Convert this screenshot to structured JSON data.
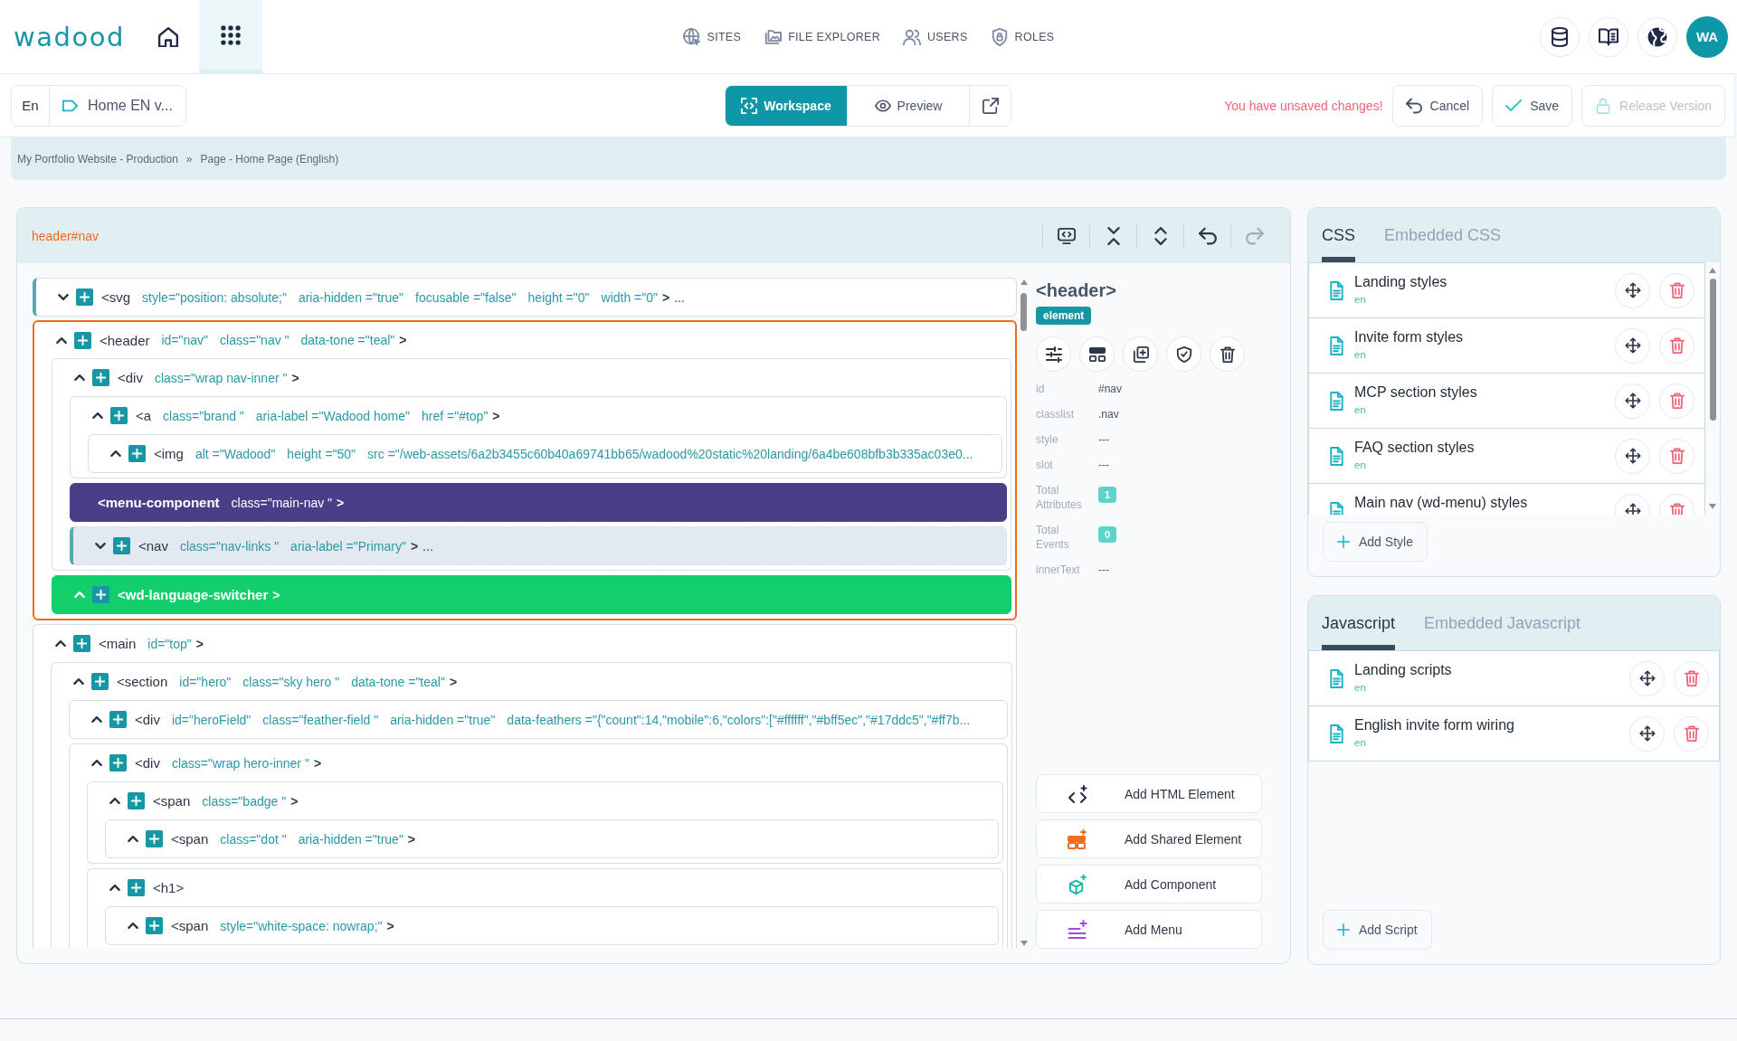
{
  "topbar": {
    "logo": "wadood",
    "home_button": {
      "selected": false
    },
    "apps_button": {
      "selected": true
    },
    "nav": [
      {
        "label": "SITES"
      },
      {
        "label": "FILE EXPLORER"
      },
      {
        "label": "USERS"
      },
      {
        "label": "ROLES"
      }
    ],
    "avatar": "WA"
  },
  "toolbar": {
    "language": "En",
    "page": "Home EN v...",
    "views": [
      {
        "label": "Workspace",
        "selected": true
      },
      {
        "label": "Preview",
        "selected": false
      }
    ],
    "notice": "You have unsaved changes!",
    "actions": [
      {
        "label": "Cancel",
        "disabled": false
      },
      {
        "label": "Save",
        "disabled": false
      },
      {
        "label": "Release Version",
        "disabled": true
      }
    ]
  },
  "breadcrumb": {
    "items": [
      "My Portfolio Website - Production",
      "Page - Home Page (English)"
    ],
    "separator": "»"
  },
  "editor": {
    "path": "header#nav",
    "tools": [
      {
        "disabled": false
      },
      {
        "disabled": false
      },
      {
        "disabled": false
      },
      {
        "disabled": false
      },
      {
        "disabled": true
      }
    ],
    "tree": [
      {
        "tag": "<svg",
        "attributes": [
          "style=\"position: absolute;\"",
          "aria-hidden =\"true\"",
          "focusable =\"false\"",
          "height =\"0\"",
          "width =\"0\""
        ],
        "end": ">",
        "more": "...",
        "kind": "element",
        "expanded": false,
        "selected": false,
        "highlighted": false
      },
      {
        "tag": "<header",
        "attributes": [
          "id=\"nav\"",
          "class=\"nav \"",
          "data-tone =\"teal\""
        ],
        "end": ">",
        "kind": "element",
        "expanded": true,
        "selected": true,
        "highlighted": false,
        "children": [
          {
            "tag": "<div",
            "attributes": [
              "class=\"wrap nav-inner \""
            ],
            "end": ">",
            "kind": "element",
            "expanded": true,
            "selected": false,
            "highlighted": false,
            "children": [
              {
                "tag": "<a",
                "attributes": [
                  "class=\"brand \"",
                  "aria-label =\"Wadood home\"",
                  "href =\"#top\""
                ],
                "end": ">",
                "kind": "element",
                "expanded": true,
                "selected": false,
                "highlighted": false,
                "children": [
                  {
                    "tag": "<img",
                    "attributes": [
                      "alt =\"Wadood\"",
                      "height =\"50\"",
                      "src =\"/web-assets/6a2b3455c60b40a69741bb65/wadood%20static%20landing/6a4be608bfb3b335ac03e0..."
                    ],
                    "kind": "element",
                    "expanded": true,
                    "selected": false,
                    "highlighted": false
                  }
                ]
              },
              {
                "tag": "<menu-component",
                "attributes": [
                  "class=\"main-nav \""
                ],
                "end": ">",
                "kind": "component",
                "selected": false,
                "highlighted": false
              },
              {
                "tag": "<nav",
                "attributes": [
                  "class=\"nav-links \"",
                  "aria-label =\"Primary\""
                ],
                "end": ">",
                "more": "...",
                "kind": "element",
                "expanded": false,
                "selected": false,
                "highlighted": true
              }
            ]
          },
          {
            "tag": "<wd-language-switcher",
            "end": ">",
            "kind": "shared",
            "expanded": true,
            "selected": false,
            "highlighted": false
          }
        ]
      },
      {
        "tag": "<main",
        "attributes": [
          "id=\"top\""
        ],
        "end": ">",
        "kind": "element",
        "expanded": true,
        "selected": false,
        "highlighted": false,
        "children": [
          {
            "tag": "<section",
            "attributes": [
              "id=\"hero\"",
              "class=\"sky hero \"",
              "data-tone =\"teal\""
            ],
            "end": ">",
            "kind": "element",
            "expanded": true,
            "selected": false,
            "highlighted": false,
            "children": [
              {
                "tag": "<div",
                "attributes": [
                  "id=\"heroField\"",
                  "class=\"feather-field \"",
                  "aria-hidden =\"true\"",
                  "data-feathers =\"{\"count\":14,\"mobile\":6,\"colors\":[\"#ffffff\",\"#bff5ec\",\"#17ddc5\",\"#ff7b..."
                ],
                "kind": "element",
                "expanded": true,
                "selected": false,
                "highlighted": false
              },
              {
                "tag": "<div",
                "attributes": [
                  "class=\"wrap hero-inner \""
                ],
                "end": ">",
                "kind": "element",
                "expanded": true,
                "selected": false,
                "highlighted": false,
                "children": [
                  {
                    "tag": "<span",
                    "attributes": [
                      "class=\"badge \""
                    ],
                    "end": ">",
                    "kind": "element",
                    "expanded": true,
                    "selected": false,
                    "highlighted": false,
                    "children": [
                      {
                        "tag": "<span",
                        "attributes": [
                          "class=\"dot \"",
                          "aria-hidden =\"true\""
                        ],
                        "end": ">",
                        "kind": "element",
                        "expanded": true,
                        "selected": false,
                        "highlighted": false
                      }
                    ]
                  },
                  {
                    "tag": "<h1>",
                    "kind": "element",
                    "expanded": true,
                    "selected": false,
                    "highlighted": false,
                    "children": [
                      {
                        "tag": "<span",
                        "attributes": [
                          "style=\"white-space: nowrap;\""
                        ],
                        "end": ">",
                        "kind": "element",
                        "expanded": true,
                        "selected": false,
                        "highlighted": false
                      }
                    ]
                  }
                ]
              }
            ]
          }
        ]
      }
    ],
    "inspector": {
      "title": "<header>",
      "badge": "element",
      "properties": [
        {
          "label": "id",
          "value": "#nav",
          "kind": "text"
        },
        {
          "label": "classlist",
          "value": ".nav",
          "kind": "text"
        },
        {
          "label": "style",
          "value": "---",
          "kind": "text"
        },
        {
          "label": "slot",
          "value": "---",
          "kind": "text"
        },
        {
          "label": "Total Attributes",
          "value": "1",
          "kind": "count"
        },
        {
          "label": "Total Events",
          "value": "0",
          "kind": "count"
        },
        {
          "label": "innerText",
          "value": "---",
          "kind": "text"
        }
      ]
    },
    "add_buttons": [
      {
        "label": "Add HTML Element"
      },
      {
        "label": "Add Shared Element"
      },
      {
        "label": "Add Component"
      },
      {
        "label": "Add Menu"
      }
    ]
  },
  "styles": {
    "tabs": [
      {
        "label": "CSS",
        "selected": true
      },
      {
        "label": "Embedded CSS",
        "selected": false
      }
    ],
    "items": [
      {
        "title": "Landing styles",
        "language": "en"
      },
      {
        "title": "Invite form styles",
        "language": "en"
      },
      {
        "title": "MCP section styles",
        "language": "en"
      },
      {
        "title": "FAQ section styles",
        "language": "en"
      },
      {
        "title": "Main nav (wd-menu) styles"
      }
    ],
    "add_label": "Add Style"
  },
  "scripts": {
    "tabs": [
      {
        "label": "Javascript",
        "selected": true
      },
      {
        "label": "Embedded Javascript",
        "selected": false
      }
    ],
    "items": [
      {
        "title": "Landing scripts",
        "language": "en"
      },
      {
        "title": "English invite form wiring",
        "language": "en"
      }
    ],
    "add_label": "Add Script"
  }
}
